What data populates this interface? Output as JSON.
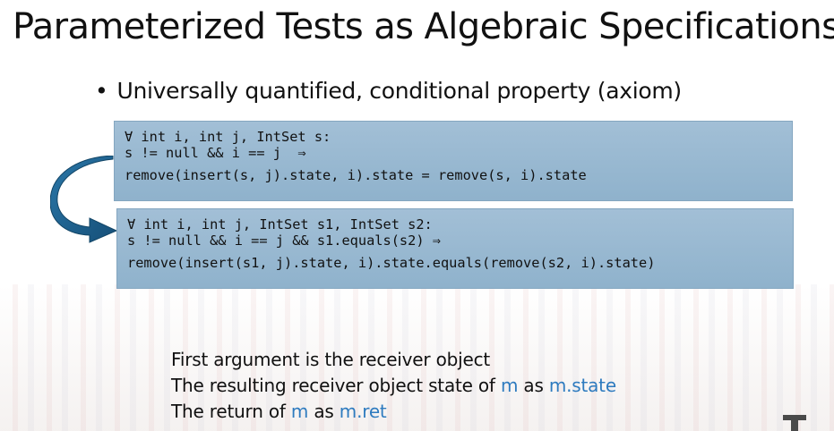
{
  "slide": {
    "title": "Parameterized Tests as Algebraic Specifications",
    "bullet": "Universally quantified, conditional property (axiom)"
  },
  "code_boxes": [
    {
      "lines": [
        "∀ int i, int j, IntSet s:",
        "s != null && i == j  ⇒",
        "remove(insert(s, j).state, i).state = remove(s, i).state"
      ]
    },
    {
      "lines": [
        "∀ int i, int j, IntSet s1, IntSet s2:",
        "s != null && i == j && s1.equals(s2) ⇒",
        "remove(insert(s1, j).state, i).state.equals(remove(s2, i).state)"
      ]
    }
  ],
  "notes": {
    "line1": "First argument is the receiver object",
    "line2_prefix": "The resulting receiver object state of ",
    "line2_m": "m",
    "line2_mid": " as ",
    "line2_state": "m.state",
    "line3_prefix": "The return of ",
    "line3_m": "m",
    "line3_mid": " as ",
    "line3_ret": "m.ret"
  },
  "colors": {
    "accent": "#2e7bbf",
    "code_box": "#97b8d0",
    "arrow": "#1f6591"
  },
  "icons": {
    "arrow": "curved-arrow-icon",
    "logo": "university-logo-icon"
  }
}
